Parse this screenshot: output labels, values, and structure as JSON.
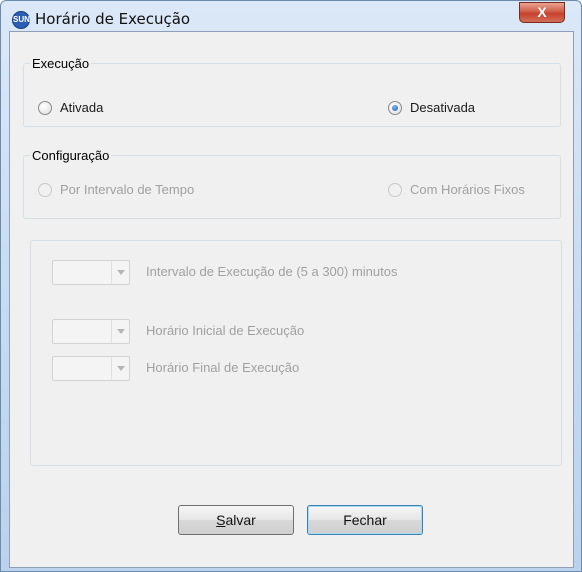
{
  "window": {
    "title": "Horário de Execução",
    "close_label": "X",
    "app_icon_label": "SUN"
  },
  "execucao": {
    "group_label": "Execução",
    "options": [
      {
        "label": "Ativada",
        "checked": false
      },
      {
        "label": "Desativada",
        "checked": true
      }
    ]
  },
  "configuracao": {
    "group_label": "Configuração",
    "options": [
      {
        "label": "Por Intervalo de Tempo",
        "checked": false,
        "disabled": true
      },
      {
        "label": "Com Horários Fixos",
        "checked": false,
        "disabled": true
      }
    ]
  },
  "fields": {
    "intervalo_label": "Intervalo de Execução de (5 a 300) minutos",
    "inicial_label": "Horário Inicial de Execução",
    "final_label": "Horário Final de Execução",
    "intervalo_value": "",
    "inicial_value": "",
    "final_value": ""
  },
  "buttons": {
    "save_label": "Salvar",
    "close_label": "Fechar"
  },
  "colors": {
    "titlebar": "#c5d9f1",
    "close_button": "#c7402a",
    "disabled_text": "#a0a0a0",
    "default_button_border": "#3c7fb1"
  }
}
